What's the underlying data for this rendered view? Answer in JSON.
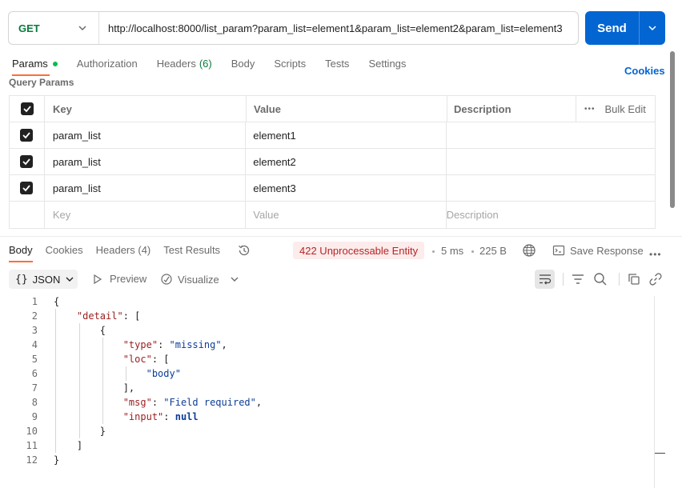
{
  "request": {
    "method": "GET",
    "url": "http://localhost:8000/list_param?param_list=element1&param_list=element2&param_list=element3",
    "send_label": "Send"
  },
  "request_tabs": {
    "params": "Params",
    "authorization": "Authorization",
    "headers": "Headers",
    "headers_count": "(6)",
    "body": "Body",
    "scripts": "Scripts",
    "tests": "Tests",
    "settings": "Settings",
    "cookies": "Cookies"
  },
  "query_params": {
    "title": "Query Params",
    "columns": {
      "key": "Key",
      "value": "Value",
      "description": "Description",
      "bulk_edit": "Bulk Edit"
    },
    "rows": [
      {
        "key": "param_list",
        "value": "element1",
        "description": ""
      },
      {
        "key": "param_list",
        "value": "element2",
        "description": ""
      },
      {
        "key": "param_list",
        "value": "element3",
        "description": ""
      }
    ],
    "placeholders": {
      "key": "Key",
      "value": "Value",
      "description": "Description"
    }
  },
  "response_tabs": {
    "body": "Body",
    "cookies": "Cookies",
    "headers": "Headers (4)",
    "test_results": "Test Results"
  },
  "response_meta": {
    "status": "422 Unprocessable Entity",
    "time": "5 ms",
    "size": "225 B",
    "save_response": "Save Response"
  },
  "response_toolbar": {
    "format": "JSON",
    "preview": "Preview",
    "visualize": "Visualize"
  },
  "code": {
    "line_numbers": [
      "1",
      "2",
      "3",
      "4",
      "5",
      "6",
      "7",
      "8",
      "9",
      "10",
      "11",
      "12"
    ],
    "keys": {
      "detail": "\"detail\"",
      "type": "\"type\"",
      "loc": "\"loc\"",
      "msg": "\"msg\"",
      "input": "\"input\""
    },
    "values": {
      "type": "\"missing\"",
      "loc_item": "\"body\"",
      "msg": "\"Field required\"",
      "input": "null"
    }
  },
  "colors": {
    "accent": "#ff6c37",
    "send": "#0265d2",
    "get_method": "#0b7a3e",
    "error_bg": "#fdecec",
    "error_text": "#b52525"
  }
}
